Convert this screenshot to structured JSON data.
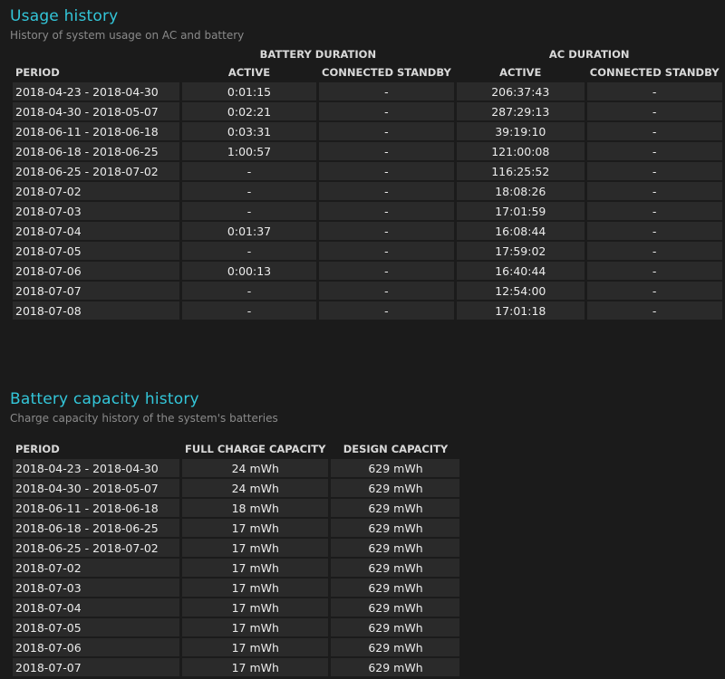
{
  "usage": {
    "title": "Usage history",
    "subtitle": "History of system usage on AC and battery",
    "group_battery": "BATTERY DURATION",
    "group_ac": "AC DURATION",
    "col_period": "PERIOD",
    "col_active": "ACTIVE",
    "col_connected_standby": "CONNECTED STANDBY",
    "rows": [
      {
        "period": "2018-04-23 - 2018-04-30",
        "bat_active": "0:01:15",
        "bat_cs": "-",
        "ac_active": "206:37:43",
        "ac_cs": "-"
      },
      {
        "period": "2018-04-30 - 2018-05-07",
        "bat_active": "0:02:21",
        "bat_cs": "-",
        "ac_active": "287:29:13",
        "ac_cs": "-"
      },
      {
        "period": "2018-06-11 - 2018-06-18",
        "bat_active": "0:03:31",
        "bat_cs": "-",
        "ac_active": "39:19:10",
        "ac_cs": "-"
      },
      {
        "period": "2018-06-18 - 2018-06-25",
        "bat_active": "1:00:57",
        "bat_cs": "-",
        "ac_active": "121:00:08",
        "ac_cs": "-"
      },
      {
        "period": "2018-06-25 - 2018-07-02",
        "bat_active": "-",
        "bat_cs": "-",
        "ac_active": "116:25:52",
        "ac_cs": "-"
      },
      {
        "period": "2018-07-02",
        "bat_active": "-",
        "bat_cs": "-",
        "ac_active": "18:08:26",
        "ac_cs": "-"
      },
      {
        "period": "2018-07-03",
        "bat_active": "-",
        "bat_cs": "-",
        "ac_active": "17:01:59",
        "ac_cs": "-"
      },
      {
        "period": "2018-07-04",
        "bat_active": "0:01:37",
        "bat_cs": "-",
        "ac_active": "16:08:44",
        "ac_cs": "-"
      },
      {
        "period": "2018-07-05",
        "bat_active": "-",
        "bat_cs": "-",
        "ac_active": "17:59:02",
        "ac_cs": "-"
      },
      {
        "period": "2018-07-06",
        "bat_active": "0:00:13",
        "bat_cs": "-",
        "ac_active": "16:40:44",
        "ac_cs": "-"
      },
      {
        "period": "2018-07-07",
        "bat_active": "-",
        "bat_cs": "-",
        "ac_active": "12:54:00",
        "ac_cs": "-"
      },
      {
        "period": "2018-07-08",
        "bat_active": "-",
        "bat_cs": "-",
        "ac_active": "17:01:18",
        "ac_cs": "-"
      }
    ]
  },
  "capacity": {
    "title": "Battery capacity history",
    "subtitle": "Charge capacity history of the system's batteries",
    "col_period": "PERIOD",
    "col_full": "FULL CHARGE CAPACITY",
    "col_design": "DESIGN CAPACITY",
    "rows": [
      {
        "period": "2018-04-23 - 2018-04-30",
        "full": "24 mWh",
        "design": "629 mWh"
      },
      {
        "period": "2018-04-30 - 2018-05-07",
        "full": "24 mWh",
        "design": "629 mWh"
      },
      {
        "period": "2018-06-11 - 2018-06-18",
        "full": "18 mWh",
        "design": "629 mWh"
      },
      {
        "period": "2018-06-18 - 2018-06-25",
        "full": "17 mWh",
        "design": "629 mWh"
      },
      {
        "period": "2018-06-25 - 2018-07-02",
        "full": "17 mWh",
        "design": "629 mWh"
      },
      {
        "period": "2018-07-02",
        "full": "17 mWh",
        "design": "629 mWh"
      },
      {
        "period": "2018-07-03",
        "full": "17 mWh",
        "design": "629 mWh"
      },
      {
        "period": "2018-07-04",
        "full": "17 mWh",
        "design": "629 mWh"
      },
      {
        "period": "2018-07-05",
        "full": "17 mWh",
        "design": "629 mWh"
      },
      {
        "period": "2018-07-06",
        "full": "17 mWh",
        "design": "629 mWh"
      },
      {
        "period": "2018-07-07",
        "full": "17 mWh",
        "design": "629 mWh"
      }
    ]
  },
  "colors": {
    "background": "#1b1b1b",
    "accent_title": "#33c6d9",
    "cell_background": "#2a2a2a",
    "subtitle_text": "#8a8a8a"
  }
}
